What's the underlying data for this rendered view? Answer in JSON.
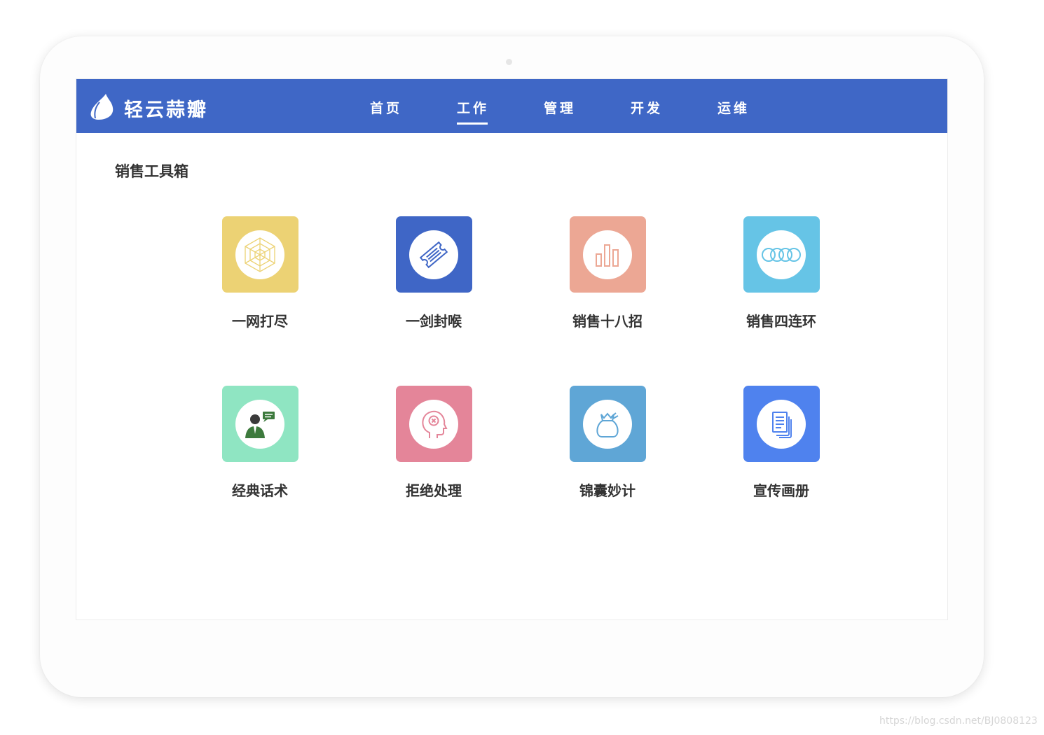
{
  "app": {
    "brand": "轻云蒜瓣"
  },
  "nav": {
    "items": [
      "首页",
      "工作",
      "管理",
      "开发",
      "运维"
    ],
    "active": "工作"
  },
  "section": {
    "title": "销售工具箱"
  },
  "tools": [
    {
      "label": "一网打尽",
      "icon": "spider-web-icon",
      "color": "#ecd274"
    },
    {
      "label": "一剑封喉",
      "icon": "ticket-icon",
      "color": "#3f66c6"
    },
    {
      "label": "销售十八招",
      "icon": "bar-chart-icon",
      "color": "#eca794"
    },
    {
      "label": "销售四连环",
      "icon": "rings-icon",
      "color": "#66c4e6"
    },
    {
      "label": "经典话术",
      "icon": "speaker-person-icon",
      "color": "#8fe5c2"
    },
    {
      "label": "拒绝处理",
      "icon": "head-reject-icon",
      "color": "#e48599"
    },
    {
      "label": "锦囊妙计",
      "icon": "pouch-icon",
      "color": "#5fa6d6"
    },
    {
      "label": "宣传画册",
      "icon": "documents-icon",
      "color": "#4f82ee"
    }
  ],
  "watermark": "https://blog.csdn.net/BJ0808123"
}
